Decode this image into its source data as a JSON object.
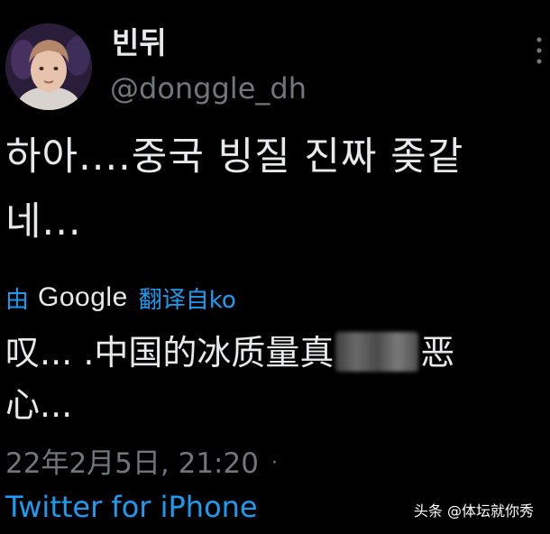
{
  "user": {
    "display_name": "빈뒤",
    "handle": "@donggle_dh"
  },
  "tweet": {
    "text_line1": "하아....중국 빙질 진짜 좆같",
    "text_line2": "네..."
  },
  "translation": {
    "by_label": "由",
    "provider": "Google",
    "action_label": "翻译自ko",
    "text_part1": "叹... .中国的冰质量真",
    "text_part2": "恶",
    "text_line2": "心..."
  },
  "meta": {
    "timestamp": "22年2月5日, 21:20",
    "separator": "·",
    "source": "Twitter for iPhone"
  },
  "watermark": {
    "text": "头条 @体坛就你秀"
  },
  "colors": {
    "background": "#000000",
    "text_primary": "#e7e9ea",
    "text_secondary": "#71767b",
    "link": "#1d9bf0"
  },
  "icons": {
    "more": "more-vertical-icon"
  }
}
